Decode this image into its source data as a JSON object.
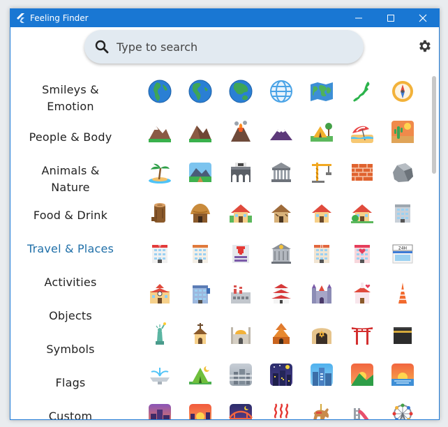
{
  "window": {
    "title": "Feeling Finder",
    "controls": [
      "minimize",
      "maximize",
      "close"
    ]
  },
  "search": {
    "placeholder": "Type to search",
    "value": ""
  },
  "categories": [
    {
      "label": "Smileys & Emotion",
      "lines": [
        "Smileys &",
        "Emotion"
      ],
      "active": false
    },
    {
      "label": "People & Body",
      "lines": [
        "People & Body"
      ],
      "active": false
    },
    {
      "label": "Animals & Nature",
      "lines": [
        "Animals &",
        "Nature"
      ],
      "active": false
    },
    {
      "label": "Food & Drink",
      "lines": [
        "Food & Drink"
      ],
      "active": false
    },
    {
      "label": "Travel & Places",
      "lines": [
        "Travel & Places"
      ],
      "active": true
    },
    {
      "label": "Activities",
      "lines": [
        "Activities"
      ],
      "active": false
    },
    {
      "label": "Objects",
      "lines": [
        "Objects"
      ],
      "active": false
    },
    {
      "label": "Symbols",
      "lines": [
        "Symbols"
      ],
      "active": false
    },
    {
      "label": "Flags",
      "lines": [
        "Flags"
      ],
      "active": false
    },
    {
      "label": "Custom",
      "lines": [
        "Custom"
      ],
      "active": false
    }
  ],
  "emoji_rows": [
    [
      "globe-europe-africa",
      "globe-americas",
      "globe-asia-australia",
      "globe-with-meridians",
      "world-map",
      "map-of-japan",
      "compass"
    ],
    [
      "snow-capped-mountain",
      "mountain",
      "volcano",
      "mount-fuji",
      "camping",
      "beach-with-umbrella",
      "desert"
    ],
    [
      "desert-island",
      "national-park",
      "stadium",
      "classical-building",
      "building-construction",
      "brick",
      "rock"
    ],
    [
      "wood",
      "hut",
      "houses",
      "derelict-house",
      "house",
      "house-with-garden",
      "office-building"
    ],
    [
      "japanese-post-office",
      "post-office",
      "hospital",
      "bank",
      "hotel",
      "love-hotel",
      "convenience-store"
    ],
    [
      "school",
      "department-store",
      "factory",
      "japanese-castle",
      "castle",
      "wedding",
      "tokyo-tower"
    ],
    [
      "statue-of-liberty",
      "church",
      "mosque",
      "hindu-temple",
      "synagogue",
      "shinto-shrine",
      "kaaba"
    ],
    [
      "fountain",
      "tent",
      "foggy",
      "night-with-stars",
      "cityscape",
      "sunrise-over-mountains",
      "sunrise"
    ],
    [
      "cityscape-at-dusk",
      "sunset",
      "bridge-at-night",
      "hot-springs",
      "carousel-horse",
      "playground-slide",
      "ferris-wheel"
    ]
  ],
  "colors": {
    "titlebar": "#1977d3",
    "active_category": "#1f6fa8",
    "search_bg": "#e2eaf1"
  }
}
